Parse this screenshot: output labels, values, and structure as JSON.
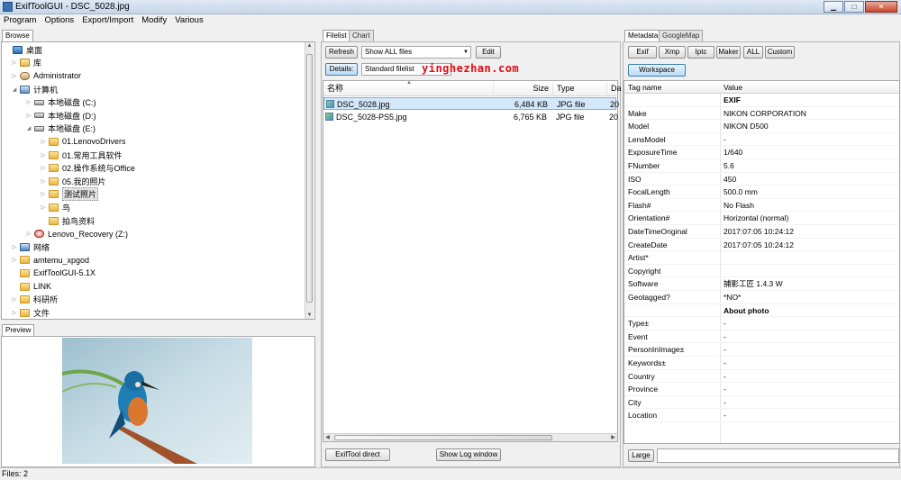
{
  "window": {
    "title": "ExifToolGUI - DSC_5028.jpg"
  },
  "menu": {
    "items": [
      "Program",
      "Options",
      "Export/Import",
      "Modify",
      "Various"
    ]
  },
  "browse": {
    "tab_label": "Browse",
    "tree": [
      {
        "label": "桌面",
        "icon": "desktop-icon",
        "expand": ""
      },
      {
        "label": "库",
        "icon": "library-folder-icon",
        "expand": "▷"
      },
      {
        "label": "Administrator",
        "icon": "user-folder-icon",
        "expand": "▷"
      },
      {
        "label": "计算机",
        "icon": "computer-icon",
        "expand": "◢"
      },
      {
        "label": "本地磁盘 (C:)",
        "icon": "system-drive-icon",
        "expand": "▷"
      },
      {
        "label": "本地磁盘 (D:)",
        "icon": "drive-icon",
        "expand": "▷"
      },
      {
        "label": "本地磁盘 (E:)",
        "icon": "drive-icon",
        "expand": "◢"
      },
      {
        "label": "01.LenovoDrivers",
        "icon": "folder-icon",
        "expand": "▷"
      },
      {
        "label": "01.常用工具软件",
        "icon": "folder-icon",
        "expand": "▷"
      },
      {
        "label": "02.操作系统与Office",
        "icon": "folder-icon",
        "expand": "▷"
      },
      {
        "label": "05.我的照片",
        "icon": "folder-icon",
        "expand": "▷"
      },
      {
        "label": "测试照片",
        "icon": "folder-icon",
        "expand": "▷",
        "selected": true
      },
      {
        "label": "鸟",
        "icon": "folder-icon",
        "expand": "▷"
      },
      {
        "label": "拍鸟资料",
        "icon": "folder-icon",
        "expand": ""
      },
      {
        "label": "Lenovo_Recovery (Z:)",
        "icon": "recovery-drive-icon",
        "expand": "▷"
      },
      {
        "label": "网络",
        "icon": "network-icon",
        "expand": "▷"
      },
      {
        "label": "amtemu_xpgod",
        "icon": "folder-icon",
        "expand": "▷"
      },
      {
        "label": "ExifToolGUI-5.1X",
        "icon": "folder-icon",
        "expand": ""
      },
      {
        "label": "LINK",
        "icon": "folder-icon",
        "expand": ""
      },
      {
        "label": "科研所",
        "icon": "folder-icon",
        "expand": "▷"
      },
      {
        "label": "文件",
        "icon": "folder-icon",
        "expand": "▷"
      }
    ]
  },
  "preview": {
    "tab_label": "Preview",
    "image_alt": "kingfisher-on-branch-photo"
  },
  "filelist": {
    "tabs": [
      "Filelist",
      "Chart"
    ],
    "refresh_label": "Refresh",
    "filter_value": "Show ALL files",
    "edit_label": "Edit",
    "details_label": "Details:",
    "view_value": "Standard filelist",
    "columns": [
      "名称",
      "Size",
      "Type",
      "Da"
    ],
    "files": [
      {
        "name": "DSC_5028.jpg",
        "size": "6,484 KB",
        "type": "JPG file",
        "date": "20",
        "selected": true
      },
      {
        "name": "DSC_5028-PS5.jpg",
        "size": "6,765 KB",
        "type": "JPG file",
        "date": "20",
        "selected": false
      }
    ],
    "exiftool_direct_label": "ExifTool direct",
    "show_log_label": "Show Log window"
  },
  "watermark": "yinghezhan.com",
  "metadata": {
    "tabs": [
      "Metadata",
      "GoogleMap"
    ],
    "buttons": [
      "Exif",
      "Xmp",
      "Iptc",
      "Maker",
      "ALL",
      "Custom"
    ],
    "workspace_label": "Workspace",
    "columns": [
      "Tag name",
      "Value"
    ],
    "rows": [
      {
        "name": "",
        "value": "EXIF",
        "group": true
      },
      {
        "name": "Make",
        "value": "NIKON CORPORATION"
      },
      {
        "name": "Model",
        "value": "NIKON D500"
      },
      {
        "name": "LensModel",
        "value": "-"
      },
      {
        "name": "ExposureTime",
        "value": "1/640"
      },
      {
        "name": "FNumber",
        "value": "5.6"
      },
      {
        "name": "ISO",
        "value": "450"
      },
      {
        "name": "FocalLength",
        "value": "500.0 mm"
      },
      {
        "name": "Flash#",
        "value": "No Flash"
      },
      {
        "name": "Orientation#",
        "value": "Horizontal (normal)"
      },
      {
        "name": "DateTimeOriginal",
        "value": "2017:07:05 10:24:12"
      },
      {
        "name": "CreateDate",
        "value": "2017:07:05 10:24:12"
      },
      {
        "name": "Artist*",
        "value": ""
      },
      {
        "name": "Copyright",
        "value": ""
      },
      {
        "name": "Software",
        "value": "捕影工匠 1.4.3 W"
      },
      {
        "name": "Geotagged?",
        "value": "*NO*"
      },
      {
        "name": "",
        "value": "About photo",
        "group": true
      },
      {
        "name": "Type±",
        "value": "-"
      },
      {
        "name": "Event",
        "value": "-"
      },
      {
        "name": "PersonInImage±",
        "value": "-"
      },
      {
        "name": "Keywords±",
        "value": "-"
      },
      {
        "name": "Country",
        "value": "-"
      },
      {
        "name": "Province",
        "value": "-"
      },
      {
        "name": "City",
        "value": "-"
      },
      {
        "name": "Location",
        "value": "-"
      }
    ],
    "large_label": "Large",
    "edit_value": ""
  },
  "status": {
    "text": "Files: 2"
  }
}
